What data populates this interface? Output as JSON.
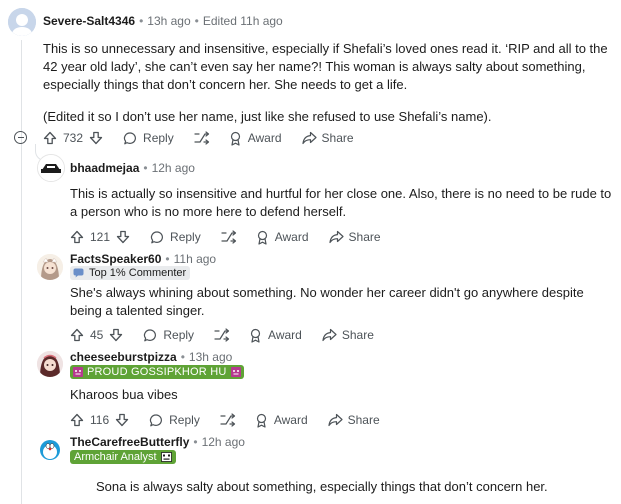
{
  "comments": [
    {
      "author": "Severe-Salt4346",
      "time": "13h ago",
      "edited": "Edited 11h ago",
      "body": [
        "This is so unnecessary and insensitive, especially if Shefali’s loved ones read it. ‘RIP and all to the 42 year old lady’, she can’t even say her name?! This woman is always salty about something, especially things that don’t concern her. She needs to get a life.",
        "(Edited it so I don’t use her name, just like she refused to use Shefali’s name)."
      ],
      "votes": "732"
    },
    {
      "author": "bhaadmejaa",
      "time": "12h ago",
      "body": [
        "This is actually so insensitive and hurtful for her close one. Also, there is no need to be rude to a person who is no more here to defend herself."
      ],
      "votes": "121"
    },
    {
      "author": "FactsSpeaker60",
      "time": "11h ago",
      "flair": "Top 1% Commenter",
      "body": [
        "She's always whining about something. No wonder her career didn't go anywhere despite being a talented singer."
      ],
      "votes": "45"
    },
    {
      "author": "cheeseeburstpizza",
      "time": "13h ago",
      "flair": "PROUD GOSSIPKHOR HU",
      "body": [
        "Kharoos bua vibes"
      ],
      "votes": "116"
    },
    {
      "author": "TheCarefreeButterfly",
      "time": "12h ago",
      "flair": "Armchair Analyst",
      "body": [
        "Sona is always salty about something, especially things that don’t concern her."
      ]
    }
  ],
  "labels": {
    "reply": "Reply",
    "award": "Award",
    "share": "Share",
    "separator": "•"
  },
  "colors": {
    "flair_green": "#5fa336",
    "flair_gray": "#e9ebed",
    "thread": "#e0e3e6"
  }
}
